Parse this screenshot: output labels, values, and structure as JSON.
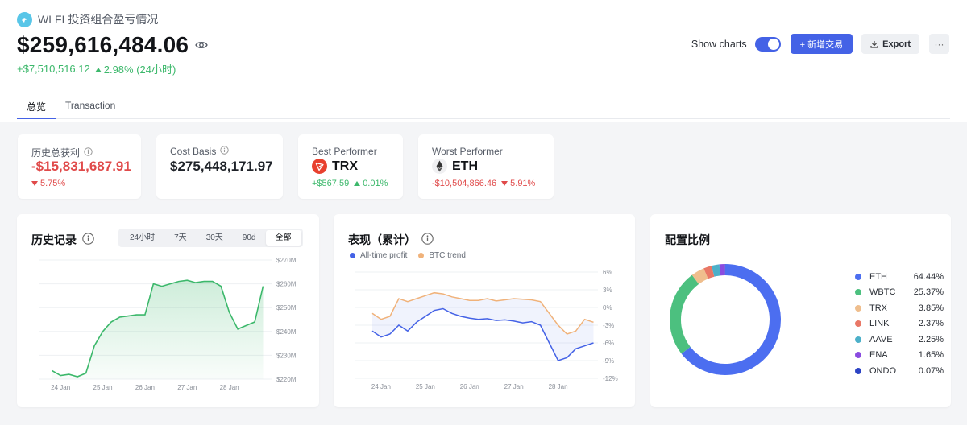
{
  "header": {
    "title": "WLFI 投资组合盈亏情况",
    "total_value": "$259,616,484.06",
    "change_abs": "+$7,510,516.12",
    "change_pct": "2.98% (24小时)",
    "show_charts_label": "Show charts",
    "show_charts_on": true,
    "add_trade_label": "+ 新增交易",
    "export_label": "Export",
    "more_label": "···"
  },
  "tabs": [
    {
      "label": "总览",
      "active": true
    },
    {
      "label": "Transaction",
      "active": false
    }
  ],
  "stats": {
    "all_time_profit": {
      "label": "历史总获利",
      "value": "-$15,831,687.91",
      "change": "5.75%"
    },
    "cost_basis": {
      "label": "Cost Basis",
      "value": "$275,448,171.97"
    },
    "best": {
      "label": "Best Performer",
      "symbol": "TRX",
      "abs": "+$567.59",
      "pct": "0.01%"
    },
    "worst": {
      "label": "Worst Performer",
      "symbol": "ETH",
      "abs": "-$10,504,866.46",
      "pct": "5.91%"
    }
  },
  "history": {
    "title": "历史记录",
    "ranges": [
      "24小时",
      "7天",
      "30天",
      "90d",
      "全部"
    ],
    "active_range": "全部"
  },
  "performance": {
    "title": "表现（累计）",
    "legend": [
      {
        "name": "All-time profit",
        "color": "#4462e6"
      },
      {
        "name": "BTC trend",
        "color": "#f0b27a"
      }
    ]
  },
  "allocation": {
    "title": "配置比例"
  },
  "colors": {
    "accent": "#4462e6",
    "positive": "#3cb86b",
    "negative": "#e04a4a"
  },
  "chart_data": [
    {
      "type": "area",
      "chart": "history",
      "x_ticks": [
        "24 Jan",
        "25 Jan",
        "26 Jan",
        "27 Jan",
        "28 Jan"
      ],
      "y_ticks": [
        "$270M",
        "$260M",
        "$250M",
        "$240M",
        "$230M",
        "$220M"
      ],
      "ylim": [
        220,
        270
      ],
      "y_unit": "$M",
      "x": [
        0,
        0.2,
        0.4,
        0.6,
        0.8,
        1.0,
        1.2,
        1.4,
        1.6,
        1.8,
        2.0,
        2.2,
        2.4,
        2.6,
        2.8,
        3.0,
        3.2,
        3.4,
        3.6,
        3.8,
        4.0,
        4.2,
        4.4,
        4.6,
        4.8,
        5.0
      ],
      "values": [
        223.5,
        221.5,
        222,
        221,
        222.5,
        234,
        240,
        244,
        246,
        246.5,
        247,
        247,
        260,
        259,
        260,
        261,
        261.5,
        260.5,
        261,
        261,
        259,
        248,
        241,
        242.5,
        244,
        259
      ],
      "xlim": [
        -0.3,
        5.2
      ],
      "color": "#3cb86b"
    },
    {
      "type": "line",
      "chart": "performance",
      "x_ticks": [
        "24 Jan",
        "25 Jan",
        "26 Jan",
        "27 Jan",
        "28 Jan"
      ],
      "y_ticks": [
        "6%",
        "3%",
        "0%",
        "-3%",
        "-6%",
        "-9%",
        "-12%"
      ],
      "ylim": [
        -12,
        6
      ],
      "xlim": [
        -0.4,
        5.1
      ],
      "x": [
        0,
        0.2,
        0.4,
        0.6,
        0.8,
        1.0,
        1.2,
        1.4,
        1.6,
        1.8,
        2.0,
        2.2,
        2.4,
        2.6,
        2.8,
        3.0,
        3.2,
        3.4,
        3.6,
        3.8,
        4.0,
        4.2,
        4.4,
        4.6,
        4.8,
        5.0
      ],
      "series": [
        {
          "name": "All-time profit",
          "color": "#4462e6",
          "values": [
            -4,
            -5,
            -4.5,
            -3,
            -4,
            -2.5,
            -1.5,
            -0.5,
            -0.2,
            -1,
            -1.5,
            -1.8,
            -2,
            -1.9,
            -2.2,
            -2.1,
            -2.3,
            -2.6,
            -2.4,
            -3,
            -6,
            -9,
            -8.5,
            -7,
            -6.5,
            -6
          ]
        },
        {
          "name": "BTC trend",
          "color": "#f0b27a",
          "values": [
            -1,
            -2,
            -1.5,
            1.5,
            1,
            1.5,
            2,
            2.5,
            2.3,
            1.8,
            1.5,
            1.2,
            1.2,
            1.5,
            1.1,
            1.3,
            1.5,
            1.4,
            1.3,
            1,
            -1,
            -3,
            -4.5,
            -4,
            -2,
            -2.5
          ]
        }
      ]
    },
    {
      "type": "pie",
      "chart": "allocation",
      "categories": [
        "ETH",
        "WBTC",
        "TRX",
        "LINK",
        "AAVE",
        "ENA",
        "ONDO"
      ],
      "values": [
        64.44,
        25.37,
        3.85,
        2.37,
        2.25,
        1.65,
        0.07
      ],
      "labels": [
        "64.44%",
        "25.37%",
        "3.85%",
        "2.37%",
        "2.25%",
        "1.65%",
        "0.07%"
      ],
      "colors": [
        "#4c6ef0",
        "#4cc07f",
        "#efbe8d",
        "#e97766",
        "#4cb0c9",
        "#8a4be0",
        "#2c43c4"
      ]
    }
  ]
}
